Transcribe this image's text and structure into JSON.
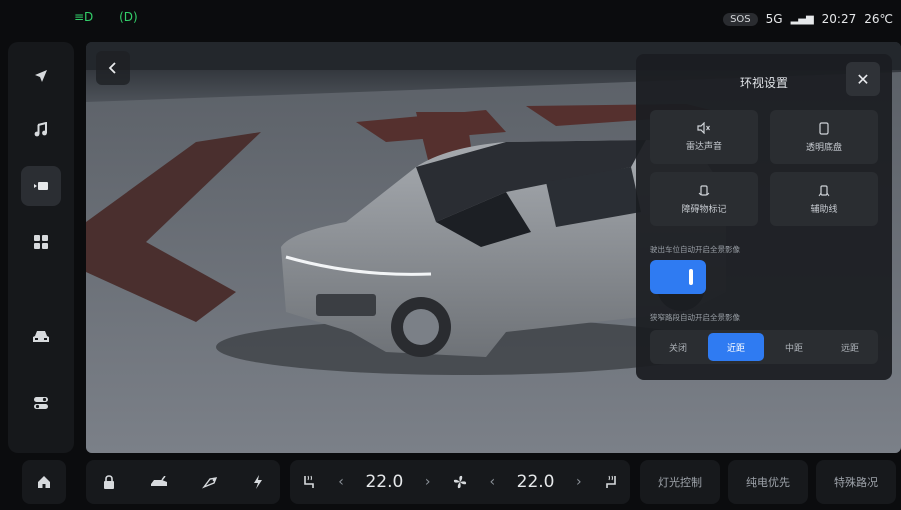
{
  "status": {
    "left_indicators": [
      "≡D",
      "(D)"
    ],
    "sos": "SOS",
    "network": "5G",
    "time": "20:27",
    "temperature": "26℃"
  },
  "sidebar": {
    "items": [
      {
        "icon": "navigation-icon"
      },
      {
        "icon": "music-icon"
      },
      {
        "icon": "camera-view-icon",
        "active": true
      },
      {
        "icon": "apps-grid-icon"
      },
      {
        "icon": "car-icon"
      },
      {
        "icon": "toggles-icon"
      }
    ]
  },
  "panel": {
    "title": "环视设置",
    "tiles": [
      {
        "label": "雷达声音",
        "icon": "speaker-mute-icon"
      },
      {
        "label": "透明底盘",
        "icon": "transparent-chassis-icon"
      },
      {
        "label": "障碍物标记",
        "icon": "obstacle-marker-icon"
      },
      {
        "label": "辅助线",
        "icon": "guide-line-icon"
      }
    ],
    "auto_exit_label": "驶出车位自动开启全景影像",
    "auto_exit_on": true,
    "narrow_label": "狭窄路段自动开启全景影像",
    "narrow_options": [
      "关闭",
      "近距",
      "中距",
      "远距"
    ],
    "narrow_selected": "近距"
  },
  "bottom": {
    "left_temp": "22.0",
    "right_temp": "22.0",
    "buttons": [
      "灯光控制",
      "纯电优先",
      "特殊路况"
    ]
  },
  "colors": {
    "accent": "#2f7bf2",
    "status_green": "#33d06a"
  }
}
